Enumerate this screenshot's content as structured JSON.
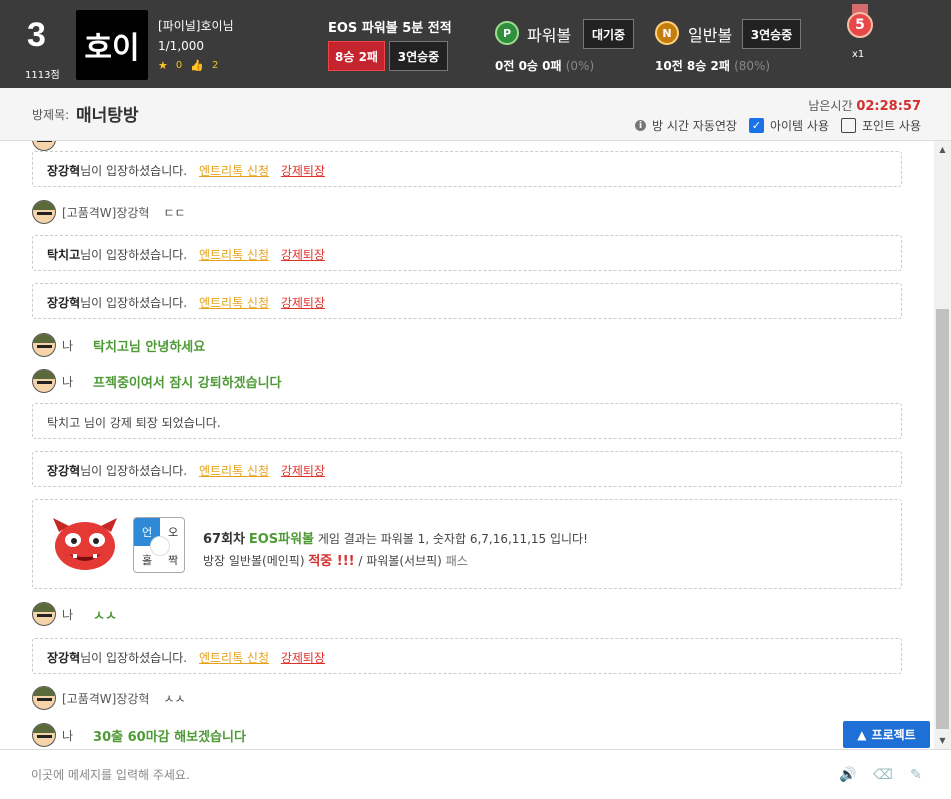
{
  "header": {
    "rank_number": "3",
    "rank_points": "1113점",
    "avatar_text": "호이",
    "user_name": "[파이널]호이님",
    "user_rank": "1/1,000",
    "stars": "0",
    "likes": "2",
    "eos_title": "EOS 파워볼 5분 전적",
    "eos_record": "8승 2패",
    "eos_streak": "3연승중",
    "powerball": {
      "ball": "P",
      "label": "파워볼",
      "status": "대기중",
      "record": "0전 0승 0패",
      "pct": "(0%)"
    },
    "normalball": {
      "ball": "N",
      "label": "일반볼",
      "status": "3연승중",
      "record": "10전 8승 2패",
      "pct": "(80%)"
    },
    "medal_number": "5",
    "medal_count": "x1"
  },
  "room": {
    "label": "방제목:",
    "name": "매너탕방",
    "time_label": "남은시간",
    "time_value": "02:28:57",
    "auto_extend": "방 시간 자동연장",
    "item_use": "아이템 사용",
    "item_use_checked": true,
    "point_use": "포인트 사용",
    "point_use_checked": false
  },
  "chat": {
    "messages": [
      {
        "type": "notice",
        "name": "장강혁",
        "text": "님이 입장하셨습니다.",
        "link1": "엔트리톡 신청",
        "link2": "강제퇴장"
      },
      {
        "type": "user",
        "who": "[고품격W]장강혁",
        "text": "ㄷㄷ"
      },
      {
        "type": "notice",
        "name": "탁치고",
        "text": "님이 입장하셨습니다.",
        "link1": "엔트리톡 신청",
        "link2": "강제퇴장"
      },
      {
        "type": "notice",
        "name": "장강혁",
        "text": "님이 입장하셨습니다.",
        "link1": "엔트리톡 신청",
        "link2": "강제퇴장"
      },
      {
        "type": "me",
        "who": "나",
        "text": "탁치고님 안녕하세요"
      },
      {
        "type": "me",
        "who": "나",
        "text": "프젝중이여서 잠시 강퇴하겠습니다"
      },
      {
        "type": "plain",
        "text": "탁치고 님이 강제 퇴장 되었습니다."
      },
      {
        "type": "notice",
        "name": "장강혁",
        "text": "님이 입장하셨습니다.",
        "link1": "엔트리톡 신청",
        "link2": "강제퇴장"
      },
      {
        "type": "me",
        "who": "나",
        "text": "ㅅㅅ"
      },
      {
        "type": "notice",
        "name": "장강혁",
        "text": "님이 입장하셨습니다.",
        "link1": "엔트리톡 신청",
        "link2": "강제퇴장"
      },
      {
        "type": "user",
        "who": "[고품격W]장강혁",
        "text": "ㅅㅅ"
      },
      {
        "type": "me",
        "who": "나",
        "text": "30출 60마감 해보겠습니다"
      }
    ],
    "result": {
      "grid": [
        "언",
        "오",
        "홀",
        "짝"
      ],
      "round": "67회차",
      "game": "EOS파워볼",
      "line1_rest": "게임 결과는 파워볼 1, 숫자합 6,7,16,11,15 입니다!",
      "line2_pre": "방장 일반볼(메인픽)",
      "line2_hit": "적중 !!!",
      "line2_mid": "/ 파워볼(서브픽)",
      "line2_pass": "패스"
    }
  },
  "project_button": "프로젝트",
  "input": {
    "placeholder": "이곳에 메세지를 입력해 주세요."
  },
  "colors": {
    "header_bg": "#3b3b3b",
    "red_badge": "#c4242d",
    "green_text": "#4e9a36",
    "link_yellow": "#e6a11a",
    "link_red": "#e0312a",
    "project_blue": "#1e6fd6"
  }
}
